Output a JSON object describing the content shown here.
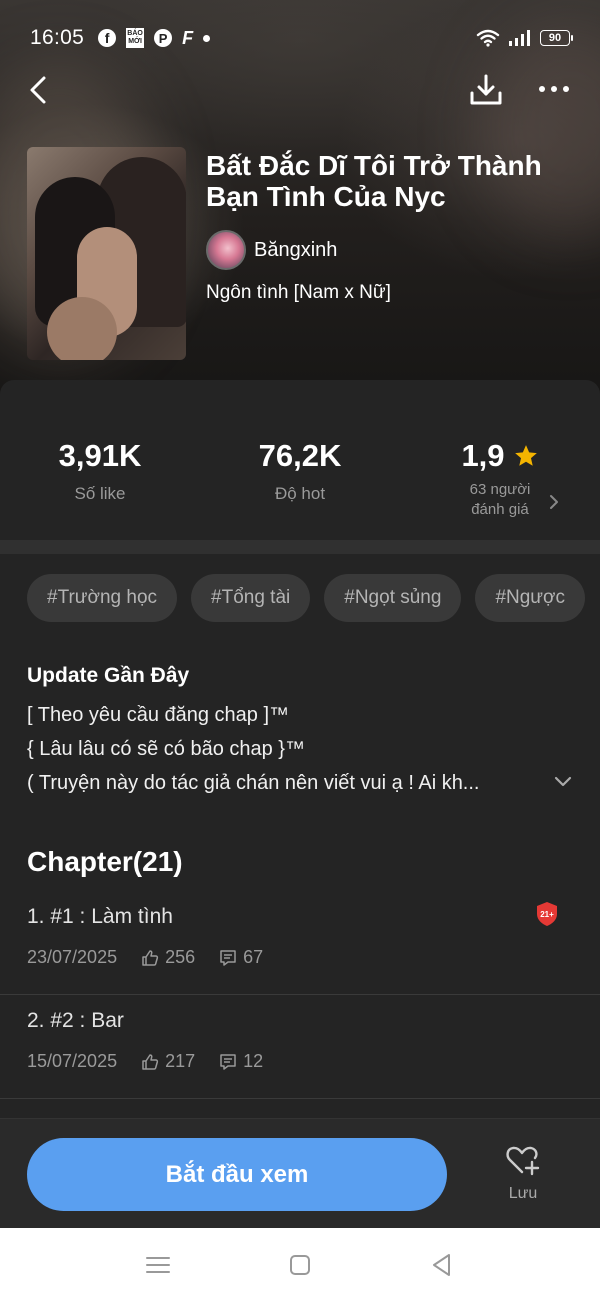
{
  "status_bar": {
    "time": "16:05",
    "app_icons": [
      "facebook-icon",
      "baomoi-icon",
      "pinterest-icon",
      "f-icon"
    ],
    "baomoi_text": "BÁO MỚI",
    "battery": "90"
  },
  "book": {
    "title": "Bất Đắc Dĩ Tôi Trở Thành Bạn Tình Của Nyc",
    "author": "Băngxinh",
    "genre": "Ngôn tình [Nam x Nữ]"
  },
  "stats": {
    "likes": {
      "value": "3,91K",
      "label": "Số like"
    },
    "hot": {
      "value": "76,2K",
      "label": "Độ hot"
    },
    "rating": {
      "value": "1,9",
      "count_line1": "63 người",
      "count_line2": "đánh giá"
    }
  },
  "tags": [
    "#Trường học",
    "#Tổng tài",
    "#Ngọt sủng",
    "#Ngược"
  ],
  "update": {
    "title": "Update Gần Đây",
    "lines": [
      "[ Theo yêu cầu đăng chap ]™",
      "{ Lâu lâu có sẽ có bão chap }™",
      "( Truyện này do tác giả chán nên viết vui ạ ! Ai kh..."
    ]
  },
  "chapters": {
    "heading": "Chapter(21)",
    "items": [
      {
        "title": "1. #1 : Làm tình",
        "date": "23/07/2025",
        "likes": "256",
        "comments": "67",
        "badge": "21+"
      },
      {
        "title": "2. #2 : Bar",
        "date": "15/07/2025",
        "likes": "217",
        "comments": "12",
        "badge": ""
      }
    ]
  },
  "actions": {
    "start_label": "Bắt đầu xem",
    "save_label": "Lưu"
  },
  "colors": {
    "accent": "#5a9ff0",
    "background": "#242424",
    "star": "#f4b400",
    "badge": "#e53935"
  }
}
